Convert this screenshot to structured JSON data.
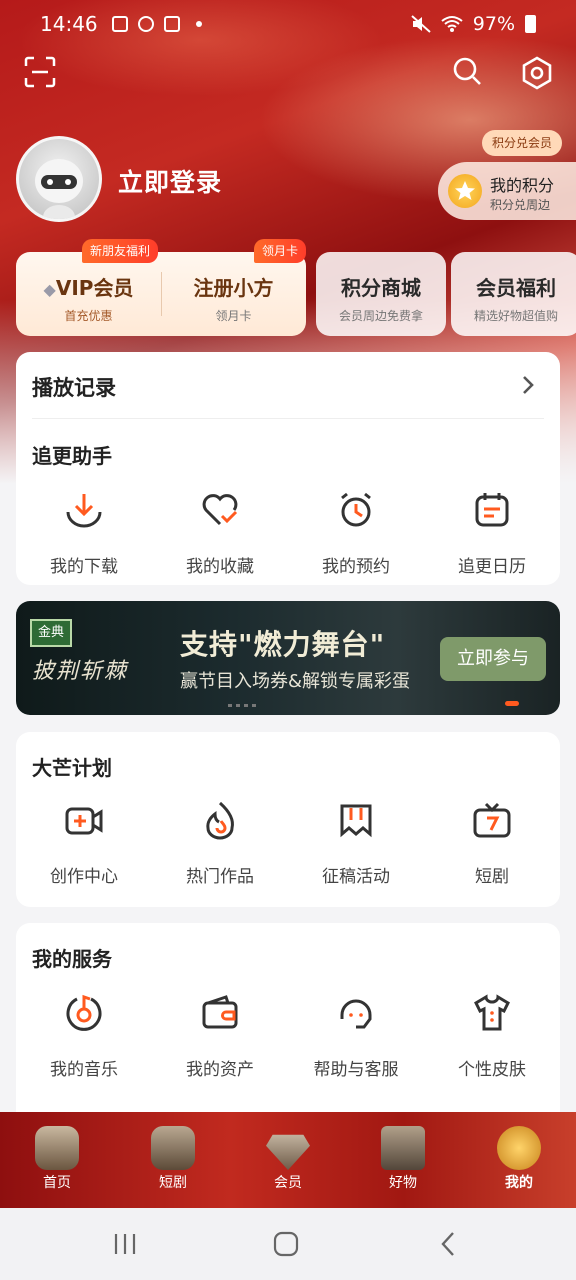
{
  "status": {
    "time": "14:46",
    "battery": "97%"
  },
  "profile": {
    "login_label": "立即登录"
  },
  "points": {
    "badge": "积分兑会员",
    "title": "我的积分",
    "subtitle": "积分兑周边"
  },
  "vip_card": {
    "vip_tag": "新朋友福利",
    "vip_title": "VIP会员",
    "vip_sub": "首充优惠",
    "reg_tag": "领月卡",
    "reg_title": "注册小方",
    "reg_sub": "领月卡"
  },
  "side_cards": [
    {
      "title": "积分商城",
      "sub": "会员周边免费拿"
    },
    {
      "title": "会员福利",
      "sub": "精选好物超值购"
    }
  ],
  "history": {
    "label": "播放记录"
  },
  "follow": {
    "title": "追更助手",
    "items": [
      {
        "label": "我的下载",
        "icon": "download-icon"
      },
      {
        "label": "我的收藏",
        "icon": "heart-icon"
      },
      {
        "label": "我的预约",
        "icon": "alarm-clock-icon"
      },
      {
        "label": "追更日历",
        "icon": "calendar-icon"
      }
    ]
  },
  "banner": {
    "logo_box": "金典",
    "brand": "披荆斩棘",
    "title": "支持\"燃力舞台\"",
    "subtitle": "赢节目入场券&解锁专属彩蛋",
    "button": "立即参与"
  },
  "damang": {
    "title": "大芒计划",
    "items": [
      {
        "label": "创作中心",
        "icon": "video-camera-plus-icon"
      },
      {
        "label": "热门作品",
        "icon": "flame-icon"
      },
      {
        "label": "征稿活动",
        "icon": "bookmark-icon"
      },
      {
        "label": "短剧",
        "icon": "tv-icon"
      }
    ]
  },
  "services": {
    "title": "我的服务",
    "items": [
      {
        "label": "我的音乐",
        "icon": "music-disc-icon"
      },
      {
        "label": "我的资产",
        "icon": "wallet-icon"
      },
      {
        "label": "帮助与客服",
        "icon": "headset-icon"
      },
      {
        "label": "个性皮肤",
        "icon": "tshirt-icon"
      }
    ]
  },
  "bottom_nav": [
    {
      "label": "首页"
    },
    {
      "label": "短剧"
    },
    {
      "label": "会员"
    },
    {
      "label": "好物"
    },
    {
      "label": "我的"
    }
  ],
  "colors": {
    "accent": "#ff5a1f",
    "hero_red": "#b51a1a"
  }
}
